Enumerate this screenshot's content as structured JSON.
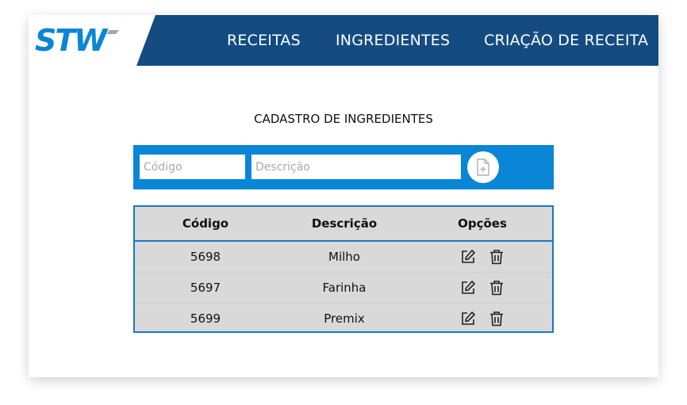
{
  "brand": {
    "logo_text": "STW",
    "accent": "#144c82",
    "form_color": "#0a86d6"
  },
  "nav": {
    "items": [
      {
        "label": "RECEITAS"
      },
      {
        "label": "INGREDIENTES"
      },
      {
        "label": "CRIAÇÃO DE RECEITA"
      }
    ]
  },
  "page": {
    "title": "CADASTRO DE INGREDIENTES"
  },
  "form": {
    "codigo_placeholder": "Código",
    "descricao_placeholder": "Descrição",
    "codigo_value": "",
    "descricao_value": "",
    "add_icon": "file-plus-icon"
  },
  "table": {
    "headers": [
      "Código",
      "Descrição",
      "Opções"
    ],
    "rows": [
      {
        "codigo": "5698",
        "descricao": "Milho"
      },
      {
        "codigo": "5697",
        "descricao": "Farinha"
      },
      {
        "codigo": "5699",
        "descricao": "Premix"
      }
    ],
    "row_icons": [
      "edit-icon",
      "trash-icon"
    ]
  }
}
